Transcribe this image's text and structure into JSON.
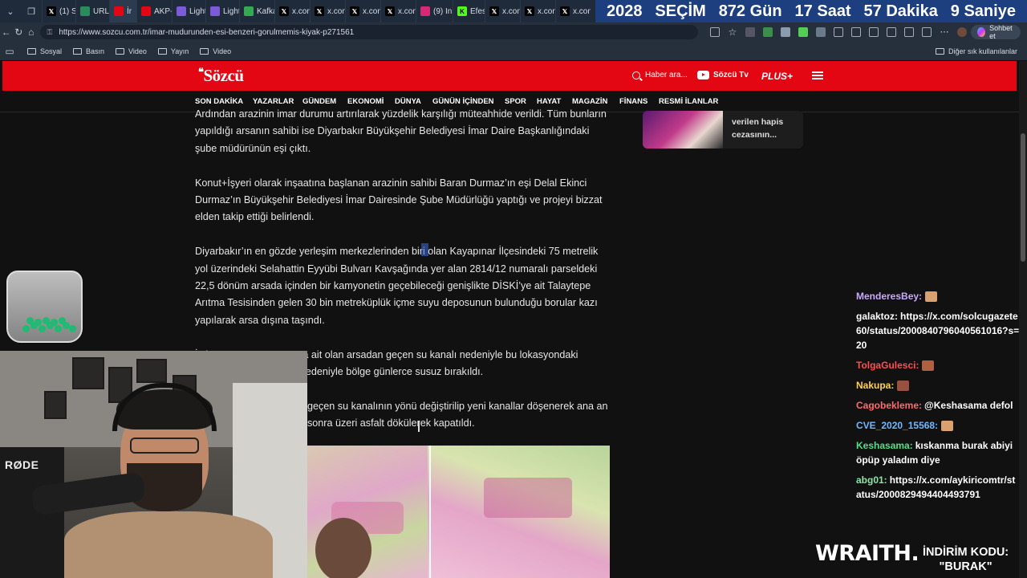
{
  "tabs": [
    {
      "label": "(1) Sı",
      "icon": "x-icon",
      "color": "#000000"
    },
    {
      "label": "URL N",
      "icon": "site-icon",
      "color": "#2a8c5a"
    },
    {
      "label": "İr",
      "icon": "sozcu-icon",
      "color": "#e30613",
      "active": true
    },
    {
      "label": "AKP-",
      "icon": "youtube-icon",
      "color": "#e30613"
    },
    {
      "label": "Light",
      "icon": "pen-icon",
      "color": "#7b5cd6"
    },
    {
      "label": "Light",
      "icon": "pen-icon",
      "color": "#7b5cd6"
    },
    {
      "label": "Kafka",
      "icon": "maps-icon",
      "color": "#34a853"
    },
    {
      "label": "x.con",
      "icon": "x-icon",
      "color": "#000000"
    },
    {
      "label": "x.con",
      "icon": "x-icon",
      "color": "#000000"
    },
    {
      "label": "x.con",
      "icon": "x-icon",
      "color": "#000000"
    },
    {
      "label": "x.con",
      "icon": "x-icon",
      "color": "#000000"
    },
    {
      "label": "(9) In",
      "icon": "instagram-icon",
      "color": "#d62976"
    },
    {
      "label": "Efes",
      "icon": "kick-icon",
      "color": "#53fc18"
    },
    {
      "label": "x.con",
      "icon": "x-icon",
      "color": "#000000"
    },
    {
      "label": "x.con",
      "icon": "x-icon",
      "color": "#000000"
    },
    {
      "label": "x.con",
      "icon": "x-icon",
      "color": "#000000"
    }
  ],
  "countdown": {
    "year": "2028",
    "label": "SEÇİM",
    "days": "872 Gün",
    "hours": "17 Saat",
    "minutes": "57 Dakika",
    "seconds": "9 Saniye"
  },
  "browser": {
    "url": "https://www.sozcu.com.tr/imar-mudurunden-esi-benzeri-gorulmemis-kiyak-p271561",
    "chat_button": "Sohbet et"
  },
  "bookmarks": {
    "items": [
      "Sosyal",
      "Basın",
      "Video",
      "Yayın",
      "Video"
    ],
    "other": "Diğer sık kullanılanlar"
  },
  "site": {
    "logo": "Sözcü",
    "search_placeholder": "Haber ara...",
    "tv_label": "Sözcü Tv",
    "plus_label": "PLUS+",
    "nav": [
      "SON DAKİKA",
      "YAZARLAR",
      "GÜNDEM",
      "EKONOMİ",
      "DÜNYA",
      "GÜNÜN İÇİNDEN",
      "SPOR",
      "HAYAT",
      "MAGAZİN",
      "FİNANS",
      "RESMİ İLANLAR"
    ],
    "side_card_text": "verilen hapis\ncezasının..."
  },
  "article": {
    "p0": "Ardından arazinin imar durumu artırılarak yüzdelik karşılığı müteahhide verildi. Tüm bunların yapıldığı arsanın sahibi ise Diyarbakır Büyükşehir Belediyesi İmar Daire Başkanlığındaki şube müdürünün eşi çıktı.",
    "p1": "Konut+İşyeri olarak inşaatına başlanan arazinin sahibi Baran Durmaz’ın eşi Delal Ekinci Durmaz’ın Büyükşehir Belediyesi İmar Dairesinde Şube Müdürlüğü yaptığı ve projeyi bizzat elden takip ettiği belirlendi.",
    "p2": "Diyarbakır’ın en gözde yerleşim merkezlerinden biri olan Kayapınar İlçesindeki 75 metrelik yol üzerindeki Selahattin Eyyübi Bulvarı Kavşağında yer alan 2814/12 numaralı parseldeki 22,5 dönüm arsada içinden bir kamyonetin geçebileceği genişlikte DİSKİ’ye ait Talaytepe Arıtma Tesisinden gelen 30 bin metreküplük içme suyu deposunun bulunduğu borular kazı yapılarak arsa dışına taşındı.",
    "p3": "İş insanı Baran Durmaz’a ait olan arsadan geçen su kanalı nedeniyle bu lokasyondaki karşılayan kanal kazısı nedeniyle bölge günlerce susuz bırakıldı.",
    "p4": "geçen su kanalının yönü değiştirilip yeni kanallar döşenerek ana an sonra üzeri asfalt dökülerek kapatıldı."
  },
  "stream": {
    "mic_brand": "RØDE",
    "sponsor": "WRAITH.",
    "promo_line1": "İNDİRİM KODU:",
    "promo_line2": "\"BURAK\""
  },
  "chat": [
    {
      "user": "MenderesBey:",
      "user_color": "#c9a8ff",
      "text": ""
    },
    {
      "user": "galaktoz:",
      "user_color": "#ffffff",
      "text": "https://x.com/solcugazete60/status/2000840796040561016?s=20"
    },
    {
      "user": "TolgaGulesci:",
      "user_color": "#ff4f4f",
      "text": ""
    },
    {
      "user": "Nakupa:",
      "user_color": "#ffd24a",
      "text": ""
    },
    {
      "user": "Cagobekleme:",
      "user_color": "#ff6b6b",
      "text": "@Keshasama defol"
    },
    {
      "user": "CVE_2020_15568:",
      "user_color": "#6fb8ff",
      "text": ""
    },
    {
      "user": "Keshasama:",
      "user_color": "#4fe08a",
      "text": "kıskanma burak abiyi öpüp yaladım diye"
    },
    {
      "user": "abg01:",
      "user_color": "#8fe3a6",
      "text": "https://x.com/aykiricomtr/status/2000829494404493791"
    }
  ],
  "colors": {
    "sozcu_red": "#e30613",
    "countdown_bg": "#1d3f7f",
    "page_bg": "#111111"
  }
}
